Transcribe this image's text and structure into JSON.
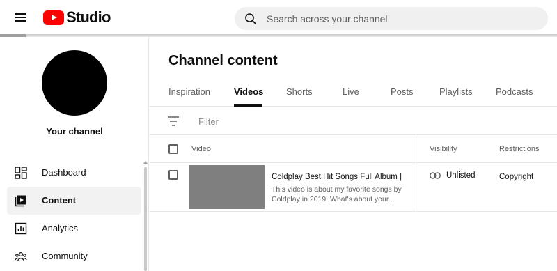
{
  "header": {
    "logo_text": "Studio",
    "search_placeholder": "Search across your channel"
  },
  "sidebar": {
    "channel_label": "Your channel",
    "items": [
      {
        "label": "Dashboard",
        "icon": "dashboard-icon",
        "active": false
      },
      {
        "label": "Content",
        "icon": "content-icon",
        "active": true
      },
      {
        "label": "Analytics",
        "icon": "analytics-icon",
        "active": false
      },
      {
        "label": "Community",
        "icon": "community-icon",
        "active": false
      }
    ]
  },
  "main": {
    "title": "Channel content",
    "tabs": [
      {
        "label": "Inspiration",
        "active": false
      },
      {
        "label": "Videos",
        "active": true
      },
      {
        "label": "Shorts",
        "active": false
      },
      {
        "label": "Live",
        "active": false
      },
      {
        "label": "Posts",
        "active": false
      },
      {
        "label": "Playlists",
        "active": false
      },
      {
        "label": "Podcasts",
        "active": false
      }
    ],
    "filter_placeholder": "Filter",
    "table": {
      "headers": {
        "video": "Video",
        "visibility": "Visibility",
        "restrictions": "Restrictions"
      },
      "rows": [
        {
          "title": "Coldplay Best Hit Songs Full Album | ...",
          "description": "This video is about my favorite songs by Coldplay in 2019. What's about your...",
          "visibility": "Unlisted",
          "restrictions": "Copyright"
        }
      ]
    }
  },
  "colors": {
    "brand_red": "#ff0000",
    "text_primary": "#0f0f0f",
    "text_secondary": "#606060",
    "active_bg": "#f2f2f2"
  }
}
